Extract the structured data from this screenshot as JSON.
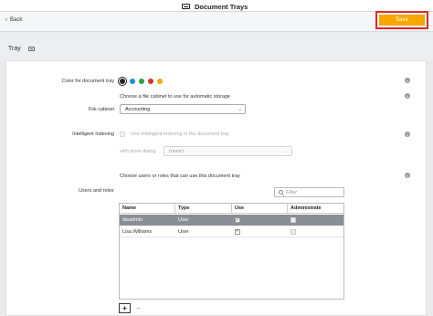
{
  "window": {
    "title": "Document Trays"
  },
  "toolbar": {
    "back_label": "Back",
    "save_label": "Save"
  },
  "section": {
    "title": "Tray"
  },
  "form": {
    "color": {
      "label": "Color for document tray",
      "options": [
        "#222222",
        "#1e8ed8",
        "#2e9d3b",
        "#d0312d",
        "#f4a800"
      ],
      "selected_index": 0
    },
    "cabinet": {
      "hint": "Choose a file cabinet to use for automatic storage",
      "label": "File cabinet",
      "value": "Accounting"
    },
    "indexing": {
      "label": "Intelligent Indexing",
      "checkbox_label": "Use intelligent indexing in the document tray",
      "store_dialog_label": "with store dialog",
      "store_dialog_value": "(none)"
    },
    "users": {
      "hint": "Choose users or roles that can use this document tray",
      "label": "Users and roles",
      "filter_placeholder": "Filter",
      "columns": [
        "Name",
        "Type",
        "Use",
        "Administrate"
      ],
      "rows": [
        {
          "name": "dwadmin",
          "type": "User",
          "use": true,
          "administrate": false
        },
        {
          "name": "Lisa.Williams",
          "type": "User",
          "use": true,
          "administrate": false
        }
      ],
      "add_label": "+",
      "remove_label": "−"
    }
  },
  "icons": {
    "info": "i",
    "check": "✓",
    "back": "‹",
    "chevron": "⌄"
  }
}
